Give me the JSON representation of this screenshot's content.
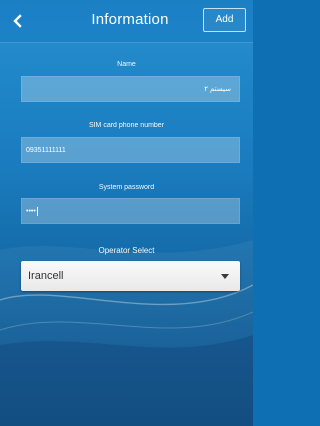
{
  "header": {
    "title": "Information",
    "add_label": "Add",
    "back_icon": "chevron-left-icon"
  },
  "form": {
    "name_label": "Name",
    "name_value": "سیستم ۲",
    "sim_label": "SIM card phone number",
    "sim_value": "09351111111",
    "password_label": "System password",
    "password_value": "••••",
    "operator_label": "Operator Select",
    "operator_value": "Irancell",
    "dropdown_icon": "caret-down-icon"
  },
  "colors": {
    "background_top": "#2a8fd0",
    "background_bottom": "#0a4f86",
    "header": "#1c82c7",
    "field_fill": "rgba(255,255,255,0.28)",
    "text": "#ffffff"
  }
}
